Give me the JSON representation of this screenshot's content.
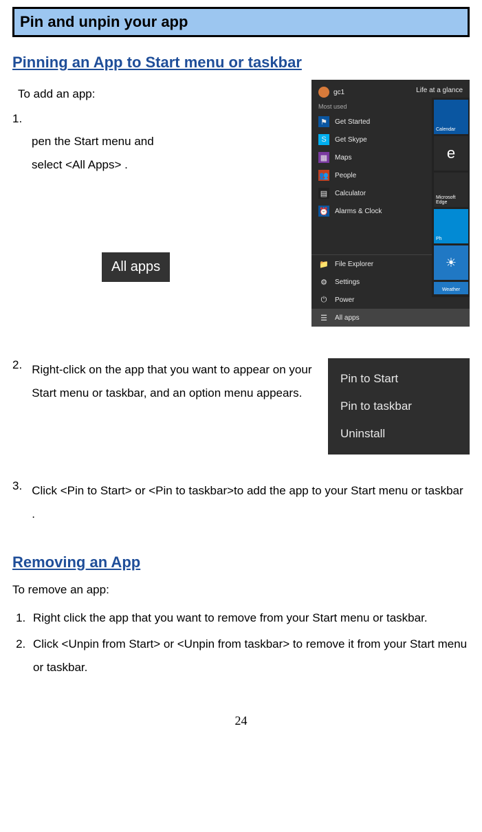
{
  "title_bar": "Pin and unpin your app",
  "section1_heading": "Pinning an App to Start menu or taskbar",
  "pinning": {
    "intro": "To add an app:",
    "step1_num": "1.",
    "step1_line1": "pen the Start menu and",
    "step1_line2": "select <All Apps> .",
    "allapps_label": "All apps",
    "step2_num": "2.",
    "step2_text": "Right-click on the app that you want to appear on your Start menu or taskbar, and an option menu appears.",
    "step3_num": "3.",
    "step3_text": "Click <Pin to Start> or <Pin to taskbar>to add the app to your Start menu or taskbar ."
  },
  "start_menu": {
    "user": "gc1",
    "life": "Life at a glance",
    "most_used": "Most used",
    "items": [
      "Get Started",
      "Get Skype",
      "Maps",
      "People",
      "Calculator",
      "Alarms & Clock"
    ],
    "bottom": [
      "File Explorer",
      "Settings",
      "Power",
      "All apps"
    ],
    "tiles": {
      "calendar": "Calendar",
      "edge": "Microsoft Edge",
      "photos": "Ph",
      "weather": "Weather"
    }
  },
  "context_menu": {
    "item1": "Pin to Start",
    "item2": "Pin to taskbar",
    "item3": "Uninstall"
  },
  "section2_heading": "Removing an App",
  "removing": {
    "intro": "To remove an app:",
    "step1": "Right click the app that you want to remove from your Start menu or taskbar.",
    "step2": "Click <Unpin from Start> or <Unpin from taskbar>    to remove it from your Start menu or taskbar."
  },
  "page_number": "24"
}
